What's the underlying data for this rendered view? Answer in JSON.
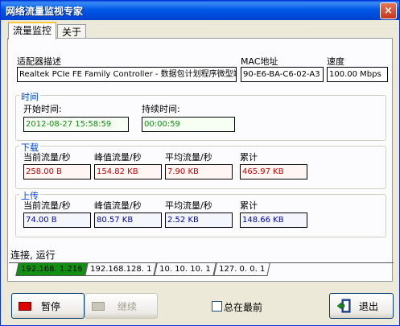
{
  "window": {
    "title": "网络流量监视专家",
    "close_symbol": "×"
  },
  "tabs": [
    {
      "label": "流量监控",
      "active": true
    },
    {
      "label": "关于",
      "active": false
    }
  ],
  "adapter": {
    "desc_label": "适配器描述",
    "desc_value": "Realtek PCIe FE Family Controller - 数据包计划程序微型端口",
    "mac_label": "MAC地址",
    "mac_value": "90-E6-BA-C6-02-A3",
    "speed_label": "速度",
    "speed_value": "100.00 Mbps"
  },
  "time": {
    "title": "时间",
    "start_label": "开始时间:",
    "start_value": "2012-08-27 15:58:59",
    "duration_label": "持续时间:",
    "duration_value": "00:00:59"
  },
  "download": {
    "title": "下载",
    "current_label": "当前流量/秒",
    "current_value": "258.00 B",
    "peak_label": "峰值流量/秒",
    "peak_value": "154.82 KB",
    "avg_label": "平均流量/秒",
    "avg_value": "7.90 KB",
    "total_label": "累计",
    "total_value": "465.97 KB"
  },
  "upload": {
    "title": "上传",
    "current_label": "当前流量/秒",
    "current_value": "74.00 B",
    "peak_label": "峰值流量/秒",
    "peak_value": "80.57 KB",
    "avg_label": "平均流量/秒",
    "avg_value": "2.52 KB",
    "total_label": "累计",
    "total_value": "148.66 KB"
  },
  "status": {
    "text": "连接, 运行"
  },
  "connections": [
    {
      "label": "192.168. 1.216",
      "active": true
    },
    {
      "label": "192.168.128. 1",
      "active": false
    },
    {
      "label": "10. 10. 10. 1",
      "active": false
    },
    {
      "label": "127. 0. 0. 1",
      "active": false
    }
  ],
  "buttons": {
    "pause_label": "暂停",
    "continue_label": "继续",
    "on_top_label": "总在最前",
    "on_top_checked": false,
    "exit_label": "退出"
  },
  "colors": {
    "title_bar": "#0058e6",
    "group_title": "#0046d5",
    "time_value": "#138a13",
    "download_value": "#c80000",
    "upload_value": "#0000b0",
    "active_connection": "#129012"
  }
}
